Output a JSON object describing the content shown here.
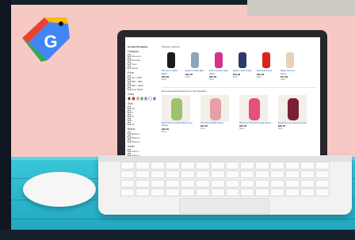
{
  "logo": {
    "letter": "G",
    "colors": {
      "red": "#ea4335",
      "yellow": "#fbbc05",
      "green": "#34a853",
      "blue": "#4285f4"
    }
  },
  "screen": {
    "sidebar": {
      "brand": "Google Shopping",
      "sections": [
        {
          "title": "Category",
          "items": [
            "Women's",
            "Dresses",
            "Tops",
            "Jeans"
          ]
        },
        {
          "title": "Price",
          "items": [
            "Up to $25",
            "$25 – $50",
            "$50 – $100",
            "Over $100"
          ]
        },
        {
          "title": "Color",
          "items": []
        },
        {
          "title": "Size",
          "items": [
            "XS",
            "S",
            "M",
            "L",
            "XL"
          ]
        },
        {
          "title": "Brand",
          "items": [
            "Brand 1",
            "Brand 2",
            "Brand 3"
          ]
        },
        {
          "title": "Seller",
          "items": [
            "Store 1",
            "Store 2"
          ]
        },
        {
          "title": "Style",
          "items": [
            "Casual",
            "Formal"
          ]
        }
      ],
      "swatches": [
        "#222222",
        "#d93025",
        "#fbbc05",
        "#34a853",
        "#4285f4",
        "#ffffff",
        "#9c27b0"
      ]
    },
    "top_row": {
      "header": "Popular products",
      "products": [
        {
          "color": "#1c1c1c",
          "title": "Women's Jacket Black",
          "price": "$59.99",
          "store": "Store"
        },
        {
          "color": "#8fa5b8",
          "title": "Denim Jacket Blue",
          "price": "$45.00",
          "store": "Store"
        },
        {
          "color": "#d6338f",
          "title": "Pink Trousers High Waist",
          "price": "$39.99",
          "store": "Store"
        },
        {
          "color": "#2d3a6b",
          "title": "Skinny Jeans Dark",
          "price": "$49.99",
          "store": "Store"
        },
        {
          "color": "#d9261c",
          "title": "Red Midi Dress",
          "price": "$69.99",
          "store": "Store"
        },
        {
          "color": "#e6d2b8",
          "title": "Beige Summer Dress",
          "price": "$54.99",
          "store": "Store"
        }
      ]
    },
    "bottom_row": {
      "header": "Recommended dresses from Top Retailers",
      "cards": [
        {
          "color": "#9cc26b",
          "title": "Floral Summer Maxi Dress Long Sleeve",
          "price": "$38.99",
          "store": "Store"
        },
        {
          "color": "#e7a0a6",
          "title": "Pink Tiered Ruffle Dress",
          "price": "$42.00",
          "store": "Store"
        },
        {
          "color": "#e2527a",
          "title": "Women's Floral Print Wrap Dress",
          "price": "$35.99",
          "store": "Store"
        },
        {
          "color": "#7b1f33",
          "title": "Burgundy Lace Evening Gown",
          "price": "$89.00",
          "store": "Store"
        }
      ]
    }
  }
}
